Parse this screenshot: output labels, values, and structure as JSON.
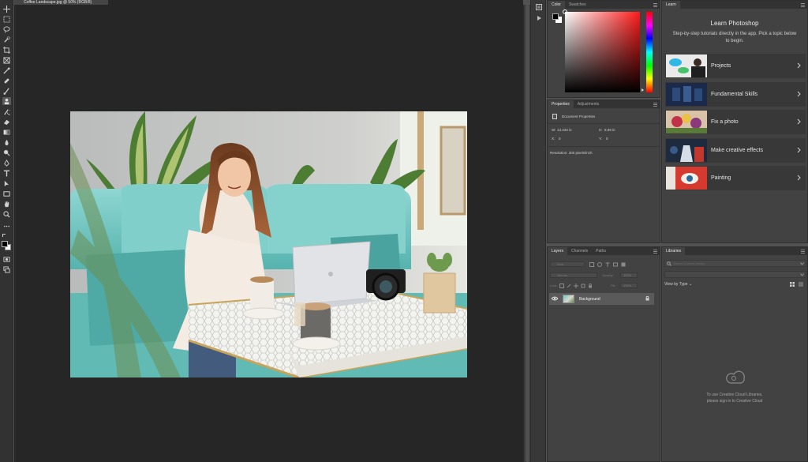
{
  "document": {
    "tab_title": "Coffee Landscape.jpg @ 50% (RGB/8)"
  },
  "color_panel": {
    "tabs": [
      "Color",
      "Swatches"
    ],
    "foreground": "#000000",
    "background": "#ffffff",
    "hue_color": "#ff1a1a"
  },
  "properties_panel": {
    "tabs": [
      "Properties",
      "Adjustments"
    ],
    "section": "Document Properties",
    "width_label": "W:",
    "width_value": "13.333 in",
    "height_label": "H:",
    "height_value": "8.89 in",
    "x_label": "X:",
    "x_value": "0",
    "y_label": "Y:",
    "y_value": "0",
    "resolution": "Resolution: 300 pixels/inch"
  },
  "layers_panel": {
    "tabs": [
      "Layers",
      "Channels",
      "Paths"
    ],
    "kind_placeholder": "Kind",
    "blend_mode": "Normal",
    "opacity_label": "Opacity:",
    "opacity_value": "100%",
    "lock_label": "Lock:",
    "fill_label": "Fill:",
    "fill_value": "100%",
    "layers": [
      {
        "name": "Background",
        "visible": true,
        "locked": true
      }
    ]
  },
  "learn_panel": {
    "tab": "Learn",
    "title": "Learn Photoshop",
    "description": "Step-by-step tutorials directly in the app. Pick a topic below to begin.",
    "items": [
      {
        "label": "Projects"
      },
      {
        "label": "Fundamental Skills"
      },
      {
        "label": "Fix a photo"
      },
      {
        "label": "Make creative effects"
      },
      {
        "label": "Painting"
      }
    ]
  },
  "libraries_panel": {
    "tab": "Libraries",
    "search_placeholder": "Search Current Library",
    "view_by": "View by Type",
    "message_line1": "To use Creative Cloud Libraries,",
    "message_line2": "please sign in to Creative Cloud"
  },
  "toolbar": {
    "tools": [
      "move-tool",
      "marquee-tool",
      "lasso-tool",
      "quick-selection-tool",
      "crop-tool",
      "frame-tool",
      "eyedropper-tool",
      "healing-brush-tool",
      "brush-tool",
      "clone-stamp-tool",
      "history-brush-tool",
      "eraser-tool",
      "gradient-tool",
      "blur-tool",
      "dodge-tool",
      "pen-tool",
      "type-tool",
      "path-selection-tool",
      "rectangle-tool",
      "hand-tool",
      "zoom-tool",
      "more-tools"
    ]
  }
}
